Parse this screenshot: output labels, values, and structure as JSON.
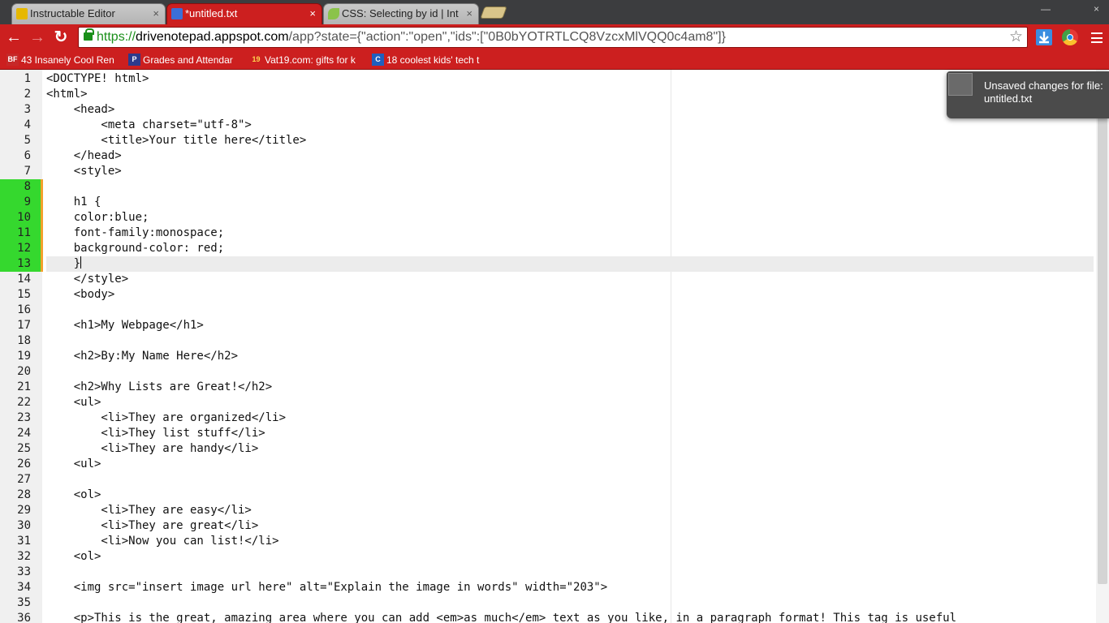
{
  "tabs": [
    {
      "title": "Instructable Editor",
      "active": false
    },
    {
      "title": "*untitled.txt",
      "active": true
    },
    {
      "title": "CSS: Selecting by id | Int",
      "active": false
    }
  ],
  "tab_close_glyph": "×",
  "address": {
    "scheme": "https://",
    "host": "drivenotepad.appspot.com",
    "rest": "/app?state={\"action\":\"open\",\"ids\":[\"0B0bYOTRTLCQ8VzcxMlVQQ0c4am8\"]}"
  },
  "bookmarks": [
    {
      "icon_text": "BF",
      "label": "43 Insanely Cool Ren",
      "icon_color": "#c62828"
    },
    {
      "icon_text": "P",
      "label": "Grades and Attendar",
      "icon_color": "#2c3a8c"
    },
    {
      "icon_text": "19",
      "label": "Vat19.com: gifts for k",
      "icon_color": "#cc1f1f"
    },
    {
      "icon_text": "C",
      "label": "18 coolest kids' tech t",
      "icon_color": "#1f5fbf"
    }
  ],
  "notification": {
    "line1": "Unsaved changes for file:",
    "line2": "untitled.txt"
  },
  "editor": {
    "line_numbers": [
      "1",
      "2",
      "3",
      "4",
      "5",
      "6",
      "7",
      "8",
      "9",
      "10",
      "11",
      "12",
      "13",
      "14",
      "15",
      "16",
      "17",
      "18",
      "19",
      "20",
      "21",
      "22",
      "23",
      "24",
      "25",
      "26",
      "27",
      "28",
      "29",
      "30",
      "31",
      "32",
      "33",
      "34",
      "35",
      "36"
    ],
    "changed_lines": [
      8,
      9,
      10,
      11,
      12,
      13
    ],
    "active_line": 13,
    "lines": [
      "<DOCTYPE! html>",
      "<html>",
      "    <head>",
      "        <meta charset=\"utf-8\">",
      "        <title>Your title here</title>",
      "    </head>",
      "    <style>",
      "",
      "    h1 {",
      "    color:blue;",
      "    font-family:monospace;",
      "    background-color: red;",
      "    }",
      "    </style>",
      "    <body>",
      "",
      "    <h1>My Webpage</h1>",
      "",
      "    <h2>By:My Name Here</h2>",
      "",
      "    <h2>Why Lists are Great!</h2>",
      "    <ul>",
      "        <li>They are organized</li>",
      "        <li>They list stuff</li>",
      "        <li>They are handy</li>",
      "    <ul>",
      "",
      "    <ol>",
      "        <li>They are easy</li>",
      "        <li>They are great</li>",
      "        <li>Now you can list!</li>",
      "    <ol>",
      "",
      "    <img src=\"insert image url here\" alt=\"Explain the image in words\" width=\"203\">",
      "",
      "    <p>This is the great, amazing area where you can add <em>as much</em> text as you like, in a paragraph format! This tag is useful"
    ]
  },
  "colors": {
    "chrome_red": "#cc1f1f",
    "changed_line_green": "#35d82e",
    "change_bar_orange": "#f2a12b"
  }
}
